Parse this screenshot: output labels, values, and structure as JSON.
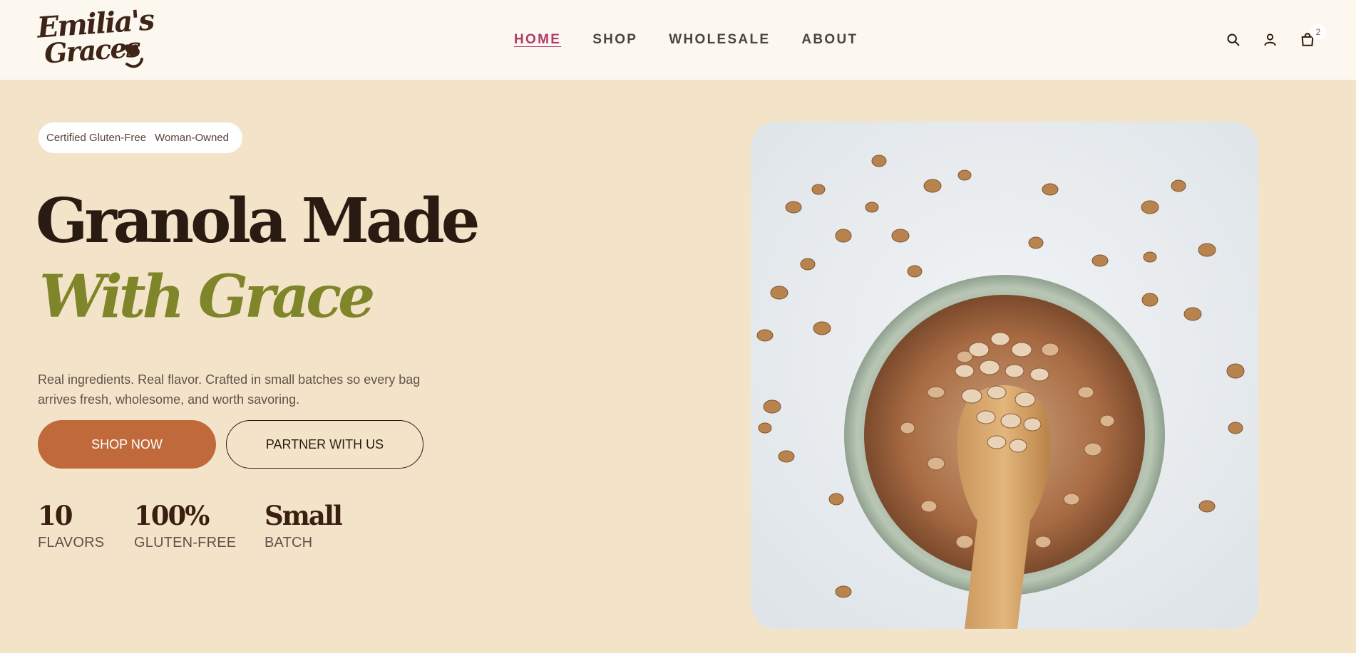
{
  "brand": {
    "logo_line1": "Emilia's",
    "logo_line2": "Graces"
  },
  "nav": {
    "items": [
      {
        "label": "HOME",
        "active": true
      },
      {
        "label": "SHOP",
        "active": false
      },
      {
        "label": "WHOLESALE",
        "active": false
      },
      {
        "label": "ABOUT",
        "active": false
      }
    ]
  },
  "header_icons": {
    "search": "search-icon",
    "account": "user-icon",
    "cart": "shopping-bag-icon",
    "cart_count": "2"
  },
  "hero": {
    "badges": [
      "Certified Gluten-Free",
      "Woman-Owned"
    ],
    "title_line1": "Granola Made",
    "title_line2": "With Grace",
    "description": "Real ingredients. Real flavor. Crafted in small batches so every bag arrives fresh, wholesome, and worth savoring.",
    "primary_button": "SHOP NOW",
    "secondary_button": "PARTNER WITH US",
    "stats": [
      {
        "value": "10",
        "label": "FLAVORS"
      },
      {
        "value": "100%",
        "label": "GLUTEN-FREE"
      },
      {
        "value": "Small",
        "label": "BATCH"
      }
    ]
  },
  "colors": {
    "header_bg": "#fcf7ef",
    "page_bg": "#f3e4c9",
    "accent_nav": "#b13a6b",
    "primary_button": "#c06a3c",
    "title_dark": "#2a1b12",
    "title_olive": "#7f8529"
  }
}
